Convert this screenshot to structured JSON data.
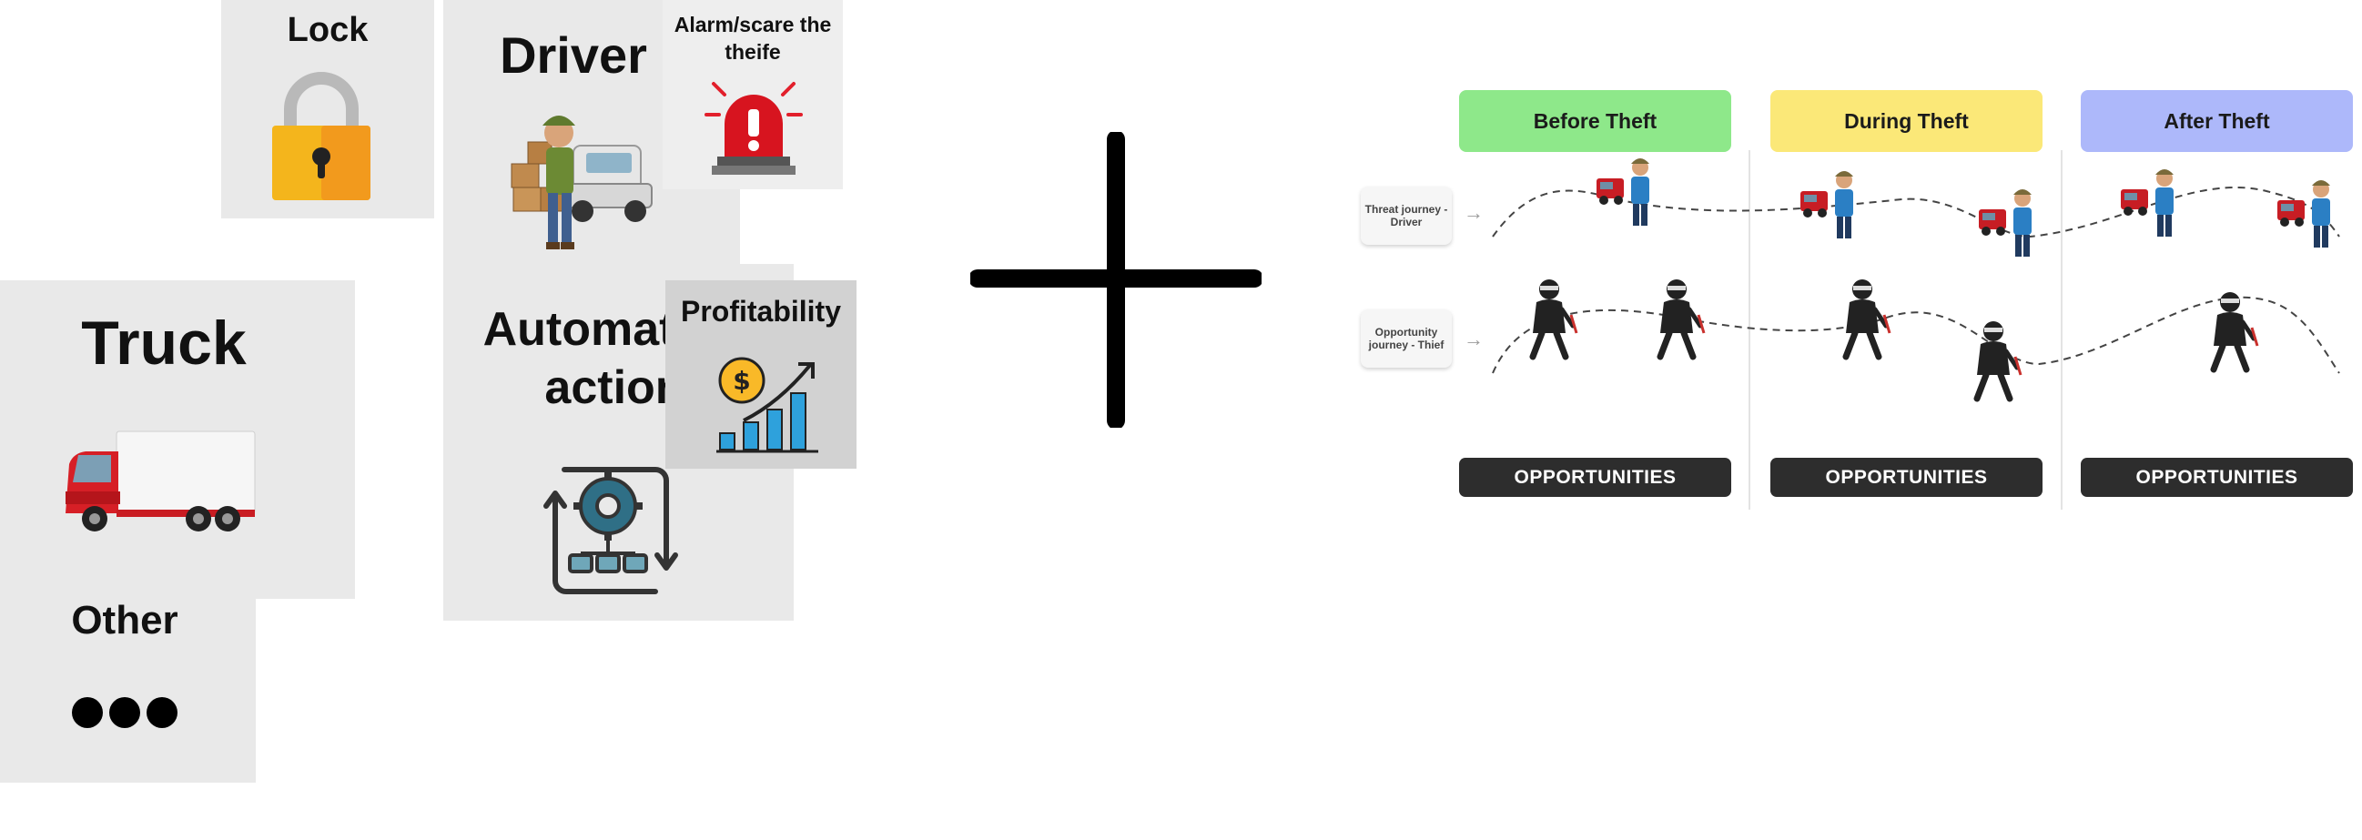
{
  "cards": {
    "lock": {
      "title": "Lock"
    },
    "driver": {
      "title": "Driver"
    },
    "alarm": {
      "title": "Alarm/scare the theife"
    },
    "truck": {
      "title": "Truck"
    },
    "automation": {
      "title": "Automation action"
    },
    "profitability": {
      "title": "Profitability"
    },
    "other": {
      "title": "Other"
    }
  },
  "journey_map": {
    "columns": [
      {
        "label": "Before Theft",
        "color": "#8ee88a"
      },
      {
        "label": "During Theft",
        "color": "#fbe878"
      },
      {
        "label": "After Theft",
        "color": "#adb8fa"
      }
    ],
    "rows": [
      {
        "label": "Threat journey - Driver"
      },
      {
        "label": "Opportunity journey - Thief"
      }
    ],
    "opportunities_label": "OPPORTUNITIES"
  },
  "icons": [
    "padlock-icon",
    "alarm-siren-icon",
    "driver-illustration",
    "red-truck-image",
    "automation-gear-icon",
    "profit-chart-icon",
    "ellipsis-icon",
    "plus-icon",
    "driver-figure-icon",
    "truck-small-icon",
    "thief-figure-icon"
  ]
}
